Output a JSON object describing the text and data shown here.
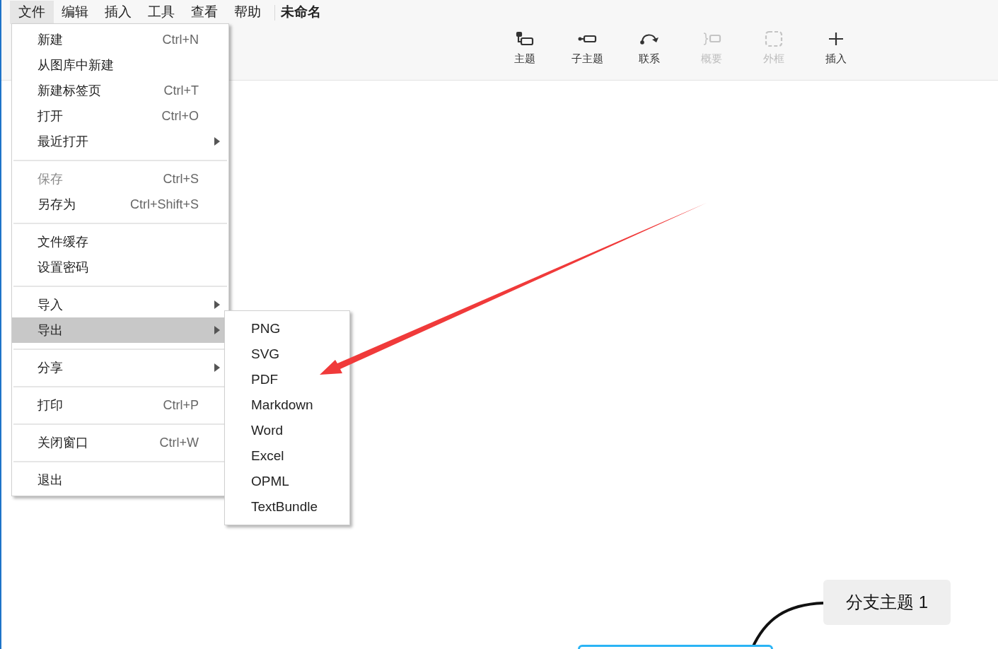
{
  "menubar": [
    {
      "label": "文件",
      "selected": true
    },
    {
      "label": "编辑",
      "selected": false
    },
    {
      "label": "插入",
      "selected": false
    },
    {
      "label": "工具",
      "selected": false
    },
    {
      "label": "查看",
      "selected": false
    },
    {
      "label": "帮助",
      "selected": false
    }
  ],
  "document_title": "未命名",
  "toolbar": [
    {
      "label": "主题",
      "kind": "topic",
      "disabled": false
    },
    {
      "label": "子主题",
      "kind": "subtopic",
      "disabled": false
    },
    {
      "label": "联系",
      "kind": "relation",
      "disabled": false
    },
    {
      "label": "概要",
      "kind": "summary",
      "disabled": true
    },
    {
      "label": "外框",
      "kind": "boundary",
      "disabled": true
    },
    {
      "label": "插入",
      "kind": "plus",
      "disabled": false
    }
  ],
  "file_menu": {
    "items": [
      {
        "kind": "item",
        "label": "新建",
        "shortcut": "Ctrl+N",
        "disabled": false,
        "submenu": false,
        "selected": false
      },
      {
        "kind": "item",
        "label": "从图库中新建",
        "disabled": false,
        "submenu": false,
        "selected": false
      },
      {
        "kind": "item",
        "label": "新建标签页",
        "shortcut": "Ctrl+T",
        "disabled": false,
        "submenu": false,
        "selected": false
      },
      {
        "kind": "item",
        "label": "打开",
        "shortcut": "Ctrl+O",
        "disabled": false,
        "submenu": false,
        "selected": false
      },
      {
        "kind": "item",
        "label": "最近打开",
        "disabled": false,
        "submenu": true,
        "selected": false
      },
      {
        "kind": "separator"
      },
      {
        "kind": "item",
        "label": "保存",
        "shortcut": "Ctrl+S",
        "disabled": true,
        "submenu": false,
        "selected": false
      },
      {
        "kind": "item",
        "label": "另存为",
        "shortcut": "Ctrl+Shift+S",
        "disabled": false,
        "submenu": false,
        "selected": false
      },
      {
        "kind": "separator"
      },
      {
        "kind": "item",
        "label": "文件缓存",
        "disabled": false,
        "submenu": false,
        "selected": false
      },
      {
        "kind": "item",
        "label": "设置密码",
        "disabled": false,
        "submenu": false,
        "selected": false
      },
      {
        "kind": "separator"
      },
      {
        "kind": "item",
        "label": "导入",
        "disabled": false,
        "submenu": true,
        "selected": false
      },
      {
        "kind": "item",
        "label": "导出",
        "disabled": false,
        "submenu": true,
        "selected": true
      },
      {
        "kind": "separator"
      },
      {
        "kind": "item",
        "label": "分享",
        "disabled": false,
        "submenu": true,
        "selected": false
      },
      {
        "kind": "separator"
      },
      {
        "kind": "item",
        "label": "打印",
        "shortcut": "Ctrl+P",
        "disabled": false,
        "submenu": false,
        "selected": false
      },
      {
        "kind": "separator"
      },
      {
        "kind": "item",
        "label": "关闭窗口",
        "shortcut": "Ctrl+W",
        "disabled": false,
        "submenu": false,
        "selected": false
      },
      {
        "kind": "separator"
      },
      {
        "kind": "item",
        "label": "退出",
        "disabled": false,
        "submenu": false,
        "selected": false
      }
    ]
  },
  "export_submenu": {
    "items": [
      {
        "label": "PNG"
      },
      {
        "label": "SVG"
      },
      {
        "label": "PDF"
      },
      {
        "label": "Markdown"
      },
      {
        "label": "Word"
      },
      {
        "label": "Excel"
      },
      {
        "label": "OPML"
      },
      {
        "label": "TextBundle"
      }
    ]
  },
  "canvas": {
    "branch_topic": {
      "label": "分支主题 1"
    }
  }
}
